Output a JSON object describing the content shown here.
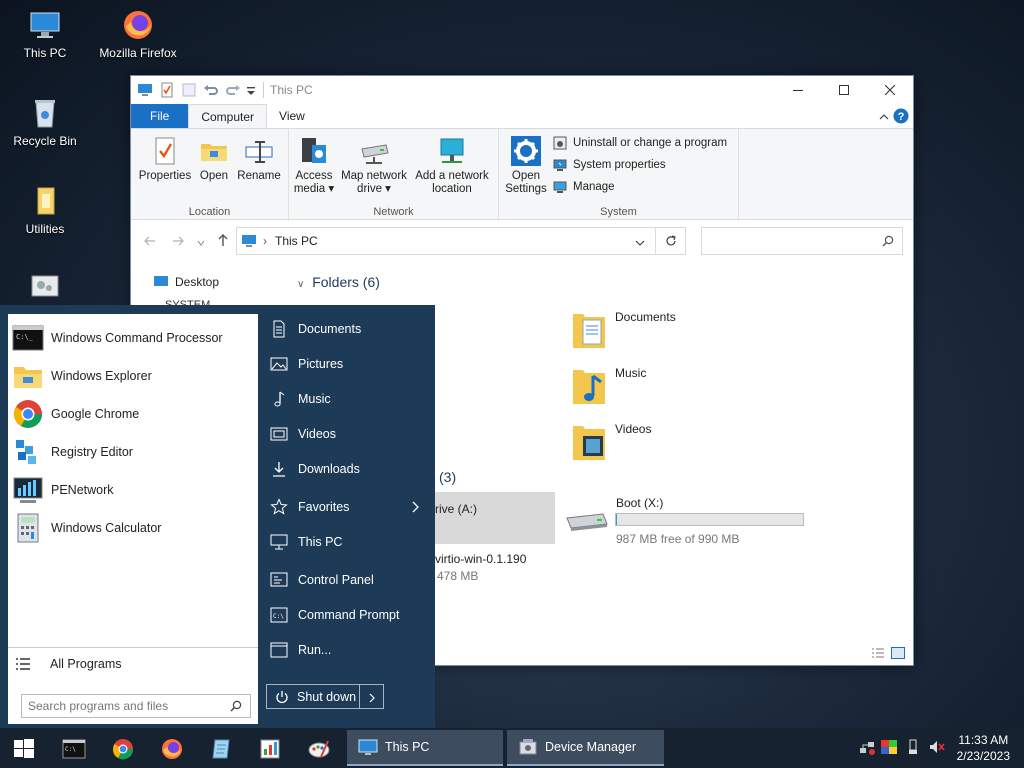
{
  "desktop": {
    "icons": [
      {
        "label": "This PC"
      },
      {
        "label": "Mozilla Firefox"
      },
      {
        "label": "Recycle Bin"
      },
      {
        "label": "Utilities"
      }
    ]
  },
  "explorer": {
    "title": "This PC",
    "tabs": {
      "file": "File",
      "computer": "Computer",
      "view": "View"
    },
    "ribbon": {
      "location": {
        "label": "Location",
        "properties": "Properties",
        "open": "Open",
        "rename": "Rename"
      },
      "network": {
        "label": "Network",
        "access_media_1": "Access",
        "access_media_2": "media ▾",
        "map_drive_1": "Map network",
        "map_drive_2": "drive ▾",
        "add_location_1": "Add a network",
        "add_location_2": "location"
      },
      "system": {
        "label": "System",
        "open_settings_1": "Open",
        "open_settings_2": "Settings",
        "uninstall": "Uninstall or change a program",
        "system_properties": "System properties",
        "manage": "Manage"
      }
    },
    "address": "This PC",
    "search_placeholder": "",
    "nav": {
      "desktop": "Desktop",
      "system": "SYSTEM"
    },
    "folders_header": "Folders (6)",
    "folders": [
      "Documents",
      "Music",
      "Videos"
    ],
    "devices_count": "(3)",
    "drive_a": {
      "name_fragment": "rive (A:)",
      "cd_fragment": "virtio-win-0.1.190",
      "size_fragment": "478 MB"
    },
    "drive_x": {
      "name": "Boot (X:)",
      "free": "987 MB free of 990 MB",
      "used_fraction": 0.003
    }
  },
  "start_menu": {
    "programs": [
      {
        "label": "Windows Command Processor"
      },
      {
        "label": "Windows Explorer"
      },
      {
        "label": "Google Chrome"
      },
      {
        "label": "Registry Editor"
      },
      {
        "label": "PENetwork"
      },
      {
        "label": "Windows Calculator"
      }
    ],
    "all_programs": "All Programs",
    "search_placeholder": "Search programs and files",
    "places": [
      {
        "label": "Documents"
      },
      {
        "label": "Pictures"
      },
      {
        "label": "Music"
      },
      {
        "label": "Videos"
      },
      {
        "label": "Downloads"
      },
      {
        "label": "Favorites"
      },
      {
        "label": "This PC"
      },
      {
        "label": "Control Panel"
      },
      {
        "label": "Command Prompt"
      },
      {
        "label": "Run..."
      }
    ],
    "shutdown": "Shut down"
  },
  "taskbar": {
    "tasks": [
      {
        "label": "This PC"
      },
      {
        "label": "Device Manager"
      }
    ],
    "time": "11:33 AM",
    "date": "2/23/2023"
  }
}
